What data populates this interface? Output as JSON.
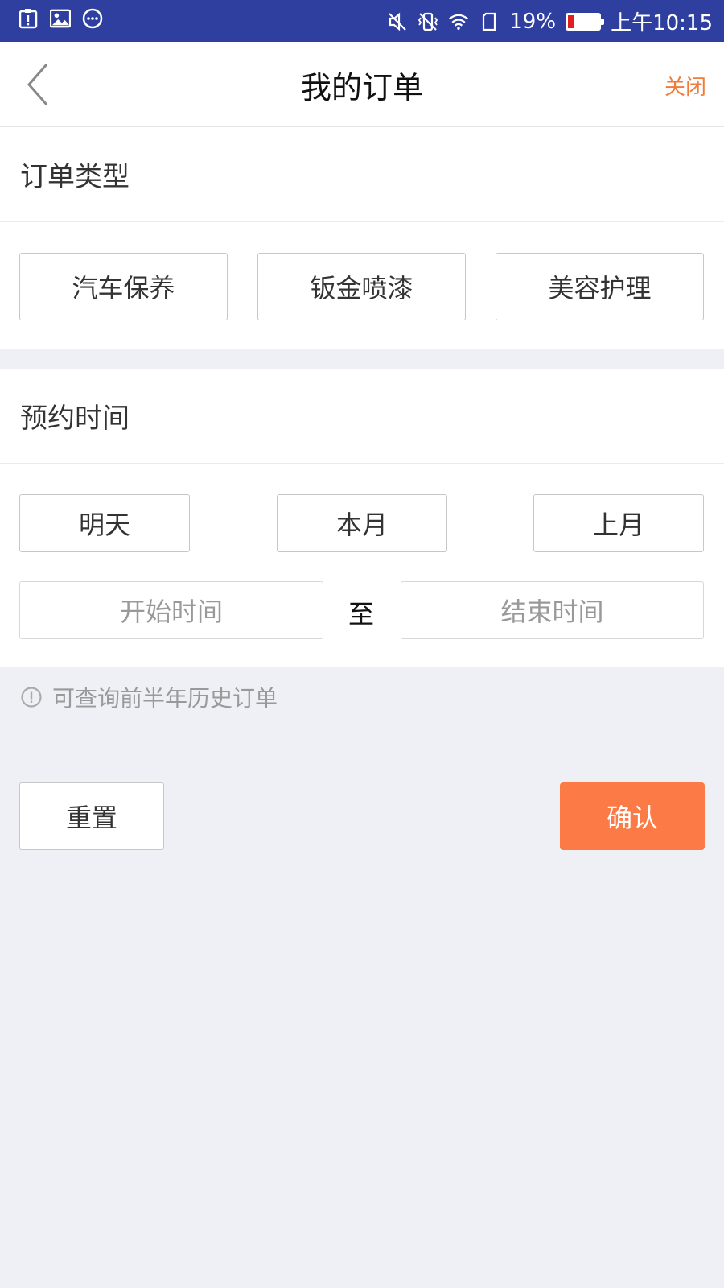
{
  "status_bar": {
    "battery_percent": "19%",
    "time": "上午10:15",
    "battery_level": 0.19,
    "left_icons": [
      "alert-clipboard-icon",
      "image-icon",
      "more-dots-icon"
    ],
    "right_icons": [
      "mute-icon",
      "vibrate-off-icon",
      "wifi-icon",
      "sim-icon",
      "battery-icon"
    ]
  },
  "nav": {
    "title": "我的订单",
    "close_label": "关闭",
    "back_icon": "chevron-left-icon"
  },
  "order_type": {
    "heading": "订单类型",
    "options": [
      "汽车保养",
      "钣金喷漆",
      "美容护理"
    ]
  },
  "booking_time": {
    "heading": "预约时间",
    "quick_options": [
      "明天",
      "本月",
      "上月"
    ],
    "start_placeholder": "开始时间",
    "to_label": "至",
    "end_placeholder": "结束时间"
  },
  "hint": {
    "text": "可查询前半年历史订单",
    "icon": "info-circle-icon"
  },
  "actions": {
    "reset_label": "重置",
    "confirm_label": "确认"
  },
  "colors": {
    "status_bar": "#2f3fa0",
    "accent": "#fb7a45",
    "close_text": "#f07b3b",
    "background": "#eef0f5"
  }
}
